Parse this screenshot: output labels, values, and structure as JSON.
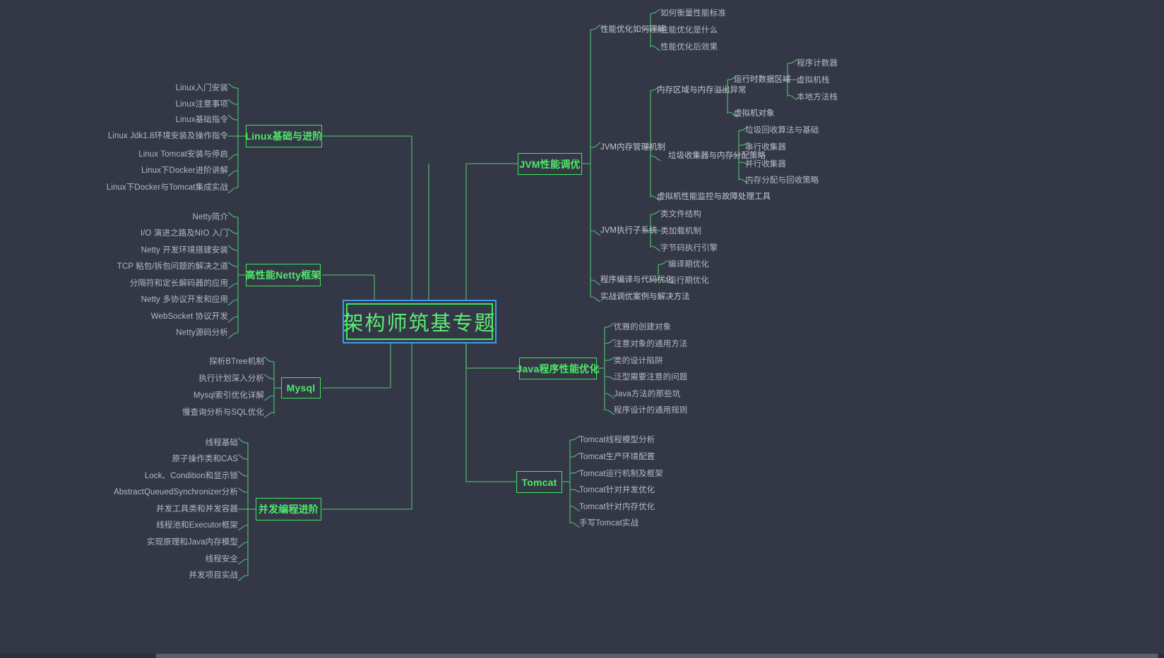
{
  "root": {
    "label": "架构师筑基专题"
  },
  "branches": {
    "linux": {
      "label": "Linux基础与进阶",
      "children": [
        "Linux入门安装",
        "Linux注意事项",
        "Linux基础指令",
        "Linux Jdk1.8环境安装及操作指令",
        "Linux Tomcat安装与停启",
        "Linux下Docker进阶讲解",
        "Linux下Docker与Tomcat集成实战"
      ]
    },
    "netty": {
      "label": "高性能Netty框架",
      "children": [
        "Netty简介",
        "I/O 演进之路及NIO 入门",
        "Netty 开发环境搭建安装",
        "TCP 粘包/拆包问题的解决之道",
        "分隔符和定长解码器的应用",
        "Netty 多协议开发和应用",
        "WebSocket 协议开发",
        "Netty源码分析"
      ]
    },
    "mysql": {
      "label": "Mysql",
      "children": [
        "探析BTree机制",
        "执行计划深入分析",
        "Mysql索引优化详解",
        "慢查询分析与SQL优化"
      ]
    },
    "concurrency": {
      "label": "并发编程进阶",
      "children": [
        "线程基础",
        "原子操作类和CAS",
        "Lock、Condition和显示锁",
        "AbstractQueuedSynchronizer分析",
        "并发工具类和并发容器",
        "线程池和Executor框架",
        "实现原理和Java内存模型",
        "线程安全",
        "并发项目实战"
      ]
    },
    "jvm": {
      "label": "JVM性能调优",
      "children": [
        {
          "label": "性能优化如何理解",
          "children": [
            "如何衡量性能标准",
            "性能优化是什么",
            "性能优化后效果"
          ]
        },
        {
          "label": "JVM内存管理机制",
          "children": [
            {
              "label": "内存区域与内存溢出异常",
              "children": [
                {
                  "label": "运行时数据区域",
                  "children": [
                    "程序计数器",
                    "虚拟机栈",
                    "本地方法栈"
                  ]
                },
                {
                  "label": "虚拟机对象",
                  "children": []
                }
              ]
            },
            {
              "label": "垃圾收集器与内存分配策略",
              "children": [
                {
                  "label": "垃圾回收算法与基础",
                  "children": []
                },
                {
                  "label": "串行收集器",
                  "children": []
                },
                {
                  "label": "并行收集器",
                  "children": []
                },
                {
                  "label": "内存分配与回收策略",
                  "children": []
                }
              ]
            },
            {
              "label": "虚拟机性能监控与故障处理工具",
              "children": []
            }
          ]
        },
        {
          "label": "JVM执行子系统",
          "children": [
            "类文件结构",
            "类加载机制",
            "字节码执行引擎"
          ]
        },
        {
          "label": "程序编译与代码优化",
          "children": [
            "编译期优化",
            "运行期优化"
          ]
        },
        {
          "label": "实战调优案例与解决方法",
          "children": []
        }
      ]
    },
    "java_perf": {
      "label": "Java程序性能优化",
      "children": [
        "优雅的创建对象",
        "注意对象的通用方法",
        "类的设计陷阱",
        "泛型需要注意的问题",
        "Java方法的那些坑",
        "程序设计的通用规则"
      ]
    },
    "tomcat": {
      "label": "Tomcat",
      "children": [
        "Tomcat线程模型分析",
        "Tomcat生产环境配置",
        "Tomcat运行机制及框架",
        "Tomcat针对并发优化",
        "Tomcat针对内存优化",
        "手写Tomcat实战"
      ]
    }
  },
  "colors": {
    "background": "#343746",
    "branch_line": "#4caf6a",
    "topic_border": "#3ce85a",
    "topic_text": "#4dea66",
    "root_outline": "#3d9be9",
    "leaf_text": "#b4b8c6"
  }
}
